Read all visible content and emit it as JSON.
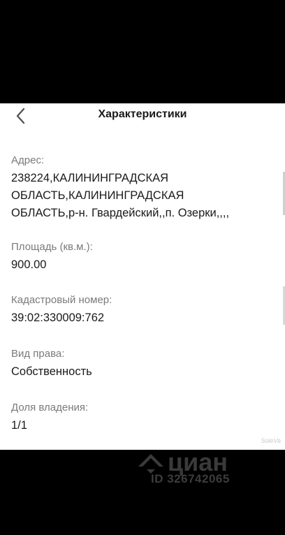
{
  "header": {
    "title": "Характеристики",
    "back_icon": "chevron-left-icon"
  },
  "fields": [
    {
      "label": "Адрес:",
      "value_lines": [
        "238224,КАЛИНИНГРАДСКАЯ",
        "ОБЛАСТЬ,КАЛИНИНГРАДСКАЯ",
        "ОБЛАСТЬ,р-н. Гвардейский,,п. Озерки,,,,"
      ]
    },
    {
      "label": "Площадь (кв.м.):",
      "value": "900.00"
    },
    {
      "label": "Кадастровый номер:",
      "value": "39:02:330009:762"
    },
    {
      "label": "Вид права:",
      "value": "Собственность"
    },
    {
      "label": "Доля владения:",
      "value": "1/1"
    }
  ],
  "watermark": {
    "brand": "циан",
    "id_text": "ID 326742065",
    "small": "SoleVa"
  },
  "colors": {
    "background": "#000000",
    "panel": "#ffffff",
    "label": "#7a7a7a",
    "value": "#1a1a1a"
  }
}
